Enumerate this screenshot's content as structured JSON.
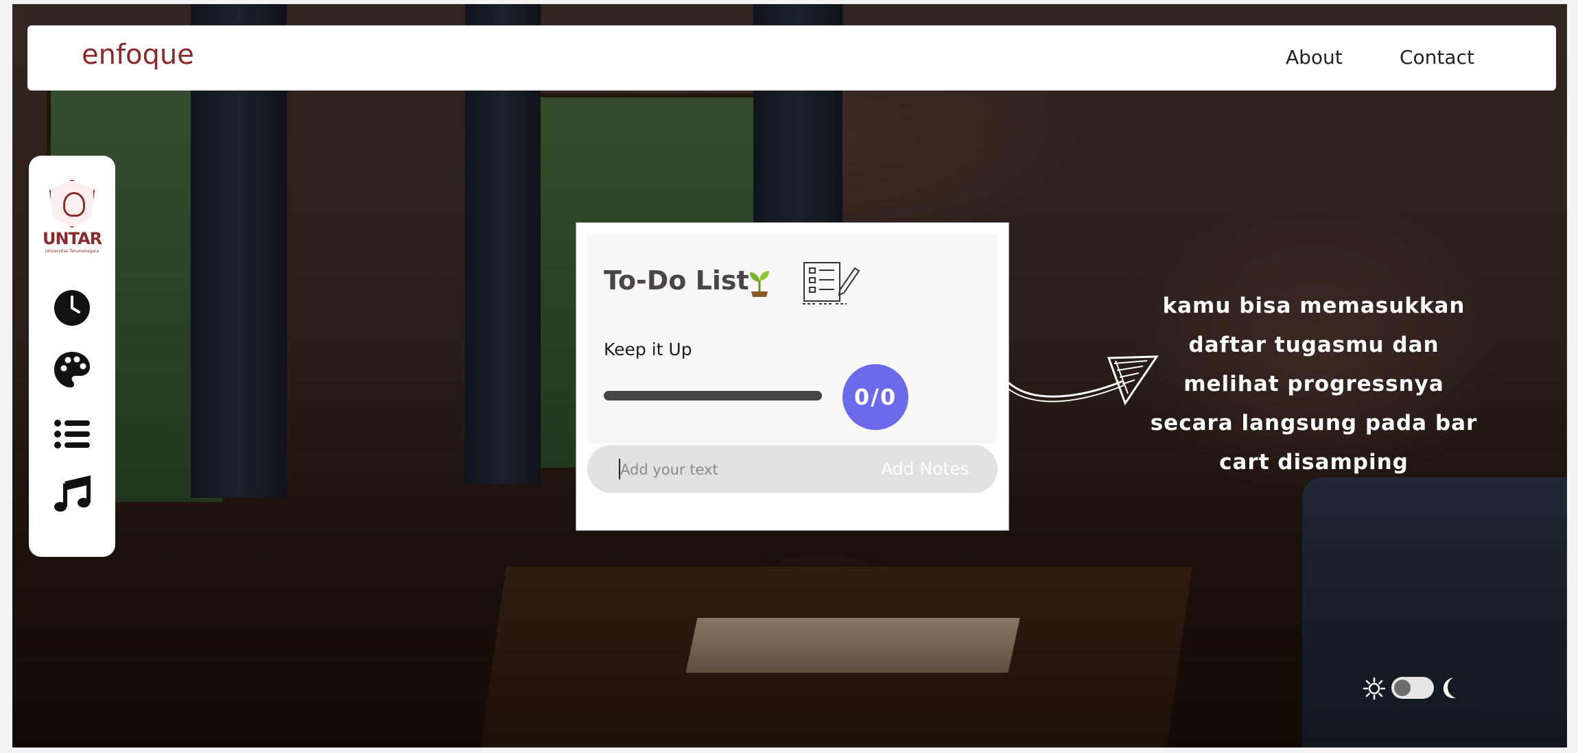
{
  "navbar": {
    "brand": "enfoque",
    "links": [
      {
        "label": "About"
      },
      {
        "label": "Contact"
      }
    ]
  },
  "sidebar": {
    "logo_text": "UNTAR",
    "logo_subtext": "Universitas Tarumanagara",
    "items": [
      {
        "icon": "clock-icon"
      },
      {
        "icon": "palette-icon"
      },
      {
        "icon": "list-icon"
      },
      {
        "icon": "music-note-icon"
      }
    ]
  },
  "todo": {
    "title": "To-Do List",
    "title_icon": "sprout-icon",
    "header_icon": "checklist-icon",
    "status_label": "Keep it Up",
    "progress_fraction": 0,
    "counter": "0/0",
    "input_placeholder": "Add your text",
    "input_value": "",
    "add_button": "Add Notes"
  },
  "hint": {
    "lines": [
      "kamu bisa memasukkan",
      "daftar tugasmu dan",
      "melihat  progressnya",
      "secara langsung pada bar",
      "cart disamping"
    ]
  },
  "theme_toggle": {
    "left_icon": "sun-icon",
    "right_icon": "moon-icon",
    "mode": "light"
  },
  "colors": {
    "brand": "#8b2a2a",
    "accent": "#6b6aea",
    "progress_track": "#444444"
  }
}
